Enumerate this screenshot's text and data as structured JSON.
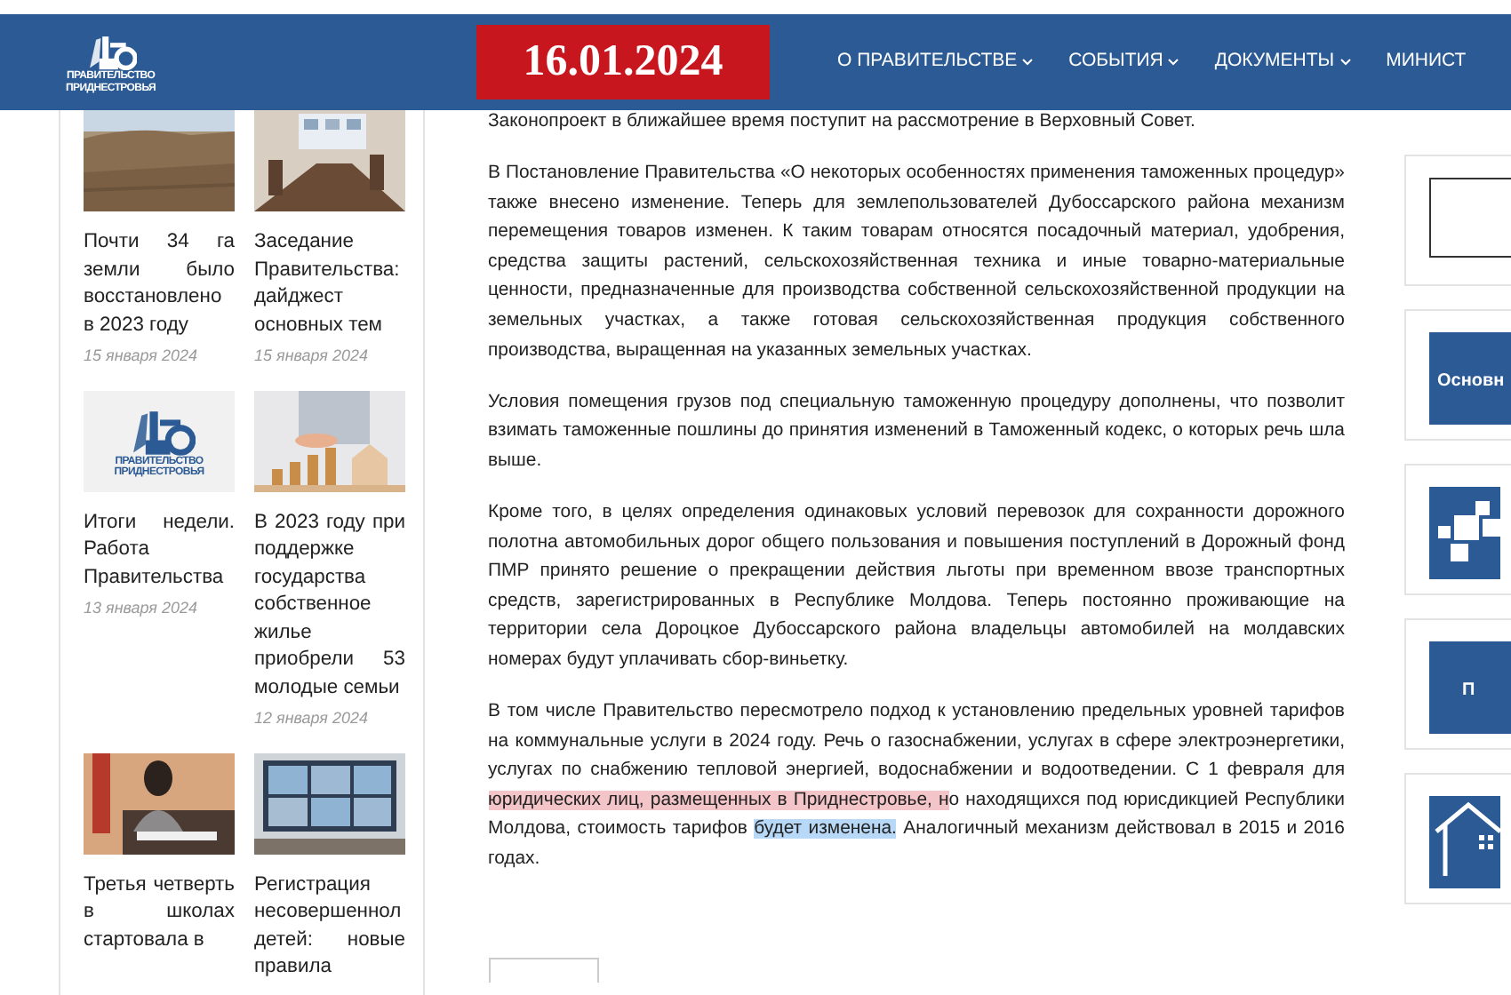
{
  "header": {
    "logo_lines": [
      "ПРАВИТЕЛЬСТВО",
      "ПРИДНЕСТРОВЬЯ"
    ],
    "date": "16.01.2024",
    "nav": [
      {
        "label": "О ПРАВИТЕЛЬСТВЕ",
        "caret": true
      },
      {
        "label": "СОБЫТИЯ",
        "caret": true
      },
      {
        "label": "ДОКУМЕНТЫ",
        "caret": true
      },
      {
        "label": "МИНИСТ",
        "caret": false
      }
    ]
  },
  "news": [
    {
      "title": "Почти 34 га земли было восстановлено в 2023 году",
      "date": "15 января 2024"
    },
    {
      "title": "Заседание Правительства: дайджест основных тем",
      "date": "15 января 2024"
    },
    {
      "title": "Итоги недели. Работа Правительства",
      "date": "13 января 2024",
      "image": {
        "kind": "logo",
        "lines": [
          "ПРАВИТЕЛЬСТВО",
          "ПРИДНЕСТРОВЬЯ"
        ]
      }
    },
    {
      "title": "В 2023 году при поддержке государства собственное жилье приобрели 53 молодые семьи",
      "date": "12 января 2024"
    },
    {
      "title": "Третья четверть в школах стартовала в"
    },
    {
      "title": "Регистрация несовершеннол детей: новые правила"
    }
  ],
  "article": {
    "paragraphs": [
      [
        {
          "text": "Законопроект в ближайшее время поступит на рассмотрение в Верховный Совет."
        }
      ],
      [
        {
          "text": "В Постановление Правительства «О некоторых особенностях применения таможенных процедур» также внесено изменение. Теперь для землепользователей Дубоссарского района механизм перемещения товаров изменен. К таким товарам относятся посадочный материал, удобрения, средства защиты растений, сельскохозяйственная техника и иные товарно-материальные ценности, предназначенные для производства собственной сельскохозяйственной продукции на земельных участках, а также готовая сельскохозяйственная продукция собственного производства, выращенная на указанных земельных участках."
        }
      ],
      [
        {
          "text": "Условия помещения грузов под специальную таможенную процедуру дополнены, что позволит взимать таможенные пошлины до принятия изменений в Таможенный кодекс, о которых речь шла выше."
        }
      ],
      [
        {
          "text": "Кроме того, в целях определения одинаковых условий перевозок для сохранности дорожного полотна автомобильных дорог общего пользования и повышения поступлений в Дорожный фонд ПМР принято решение о прекращении действия льготы при временном ввозе транспортных средств, зарегистрированных в Республике Молдова. Теперь постоянно проживающие на территории села Дороцкое Дубоссарского района владельцы автомобилей на молдавских номерах будут уплачивать сбор-виньетку."
        }
      ],
      [
        {
          "text": "В том числе Правительство пересмотрело подход к установлению предельных уровней тарифов на коммунальные услуги в 2024 году. Речь о газоснабжении, услугах в сфере электроэнергетики, услугах по снабжению тепловой энергией, водоснабжении и водоотведении. С 1 февраля для "
        },
        {
          "text": "юридических лиц, размещенных в Приднестровье, н",
          "color": "#f3c5c8"
        },
        {
          "text": "о находящихся под юрисдикцией Республики Молдова, стоимость тарифов "
        },
        {
          "text": "будет изменена.",
          "color": "#b8d8f8"
        },
        {
          "text": " Аналогичный механизм действовал в 2015 и 2016 годах."
        }
      ]
    ]
  },
  "side_banners": [
    {
      "kind": "blank"
    },
    {
      "kind": "text",
      "text": "Основн"
    },
    {
      "kind": "blocks"
    },
    {
      "kind": "text",
      "text": "П"
    },
    {
      "kind": "house"
    }
  ]
}
